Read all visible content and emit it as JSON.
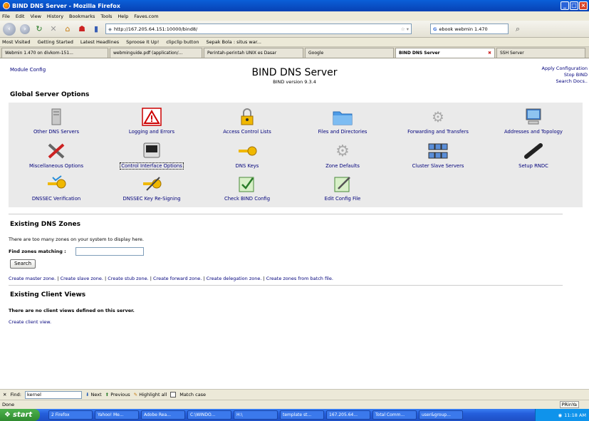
{
  "window": {
    "title": "BIND DNS Server - Mozilla Firefox"
  },
  "menu": [
    "File",
    "Edit",
    "View",
    "History",
    "Bookmarks",
    "Tools",
    "Help",
    "Faves.com"
  ],
  "url": "http://167.205.64.151:10000/bind8/",
  "search_value": "ebook webmin 1.470",
  "bookmarks": [
    "Most Visited",
    "Getting Started",
    "Latest Headlines",
    "Sproose It Up!",
    "clipclip button",
    "Sepak Bola : situs war..."
  ],
  "tabs": [
    {
      "label": "Webmin 1.470 on divkom-151...",
      "active": false
    },
    {
      "label": "webminguide.pdf (application/...",
      "active": false
    },
    {
      "label": "Perintah-perintah UNIX es Dasar",
      "active": false
    },
    {
      "label": "Google",
      "active": false
    },
    {
      "label": "BIND DNS Server",
      "active": true
    },
    {
      "label": "SSH Server",
      "active": false
    }
  ],
  "page": {
    "module_config": "Module Config",
    "title": "BIND DNS Server",
    "version": "BIND version 9.3.4",
    "right_links": [
      "Apply Configuration",
      "Stop BIND",
      "Search Docs.."
    ],
    "global_heading": "Global Server Options",
    "options": [
      {
        "label": "Other DNS Servers",
        "icon": "server-icon"
      },
      {
        "label": "Logging and Errors",
        "icon": "warning-icon"
      },
      {
        "label": "Access Control Lists",
        "icon": "lock-icon"
      },
      {
        "label": "Files and Directories",
        "icon": "folder-icon"
      },
      {
        "label": "Forwarding and Transfers",
        "icon": "gears-icon"
      },
      {
        "label": "Addresses and Topology",
        "icon": "monitor-icon"
      },
      {
        "label": "Miscellaneous Options",
        "icon": "tools-icon"
      },
      {
        "label": "Control Interface Options",
        "icon": "terminal-icon"
      },
      {
        "label": "DNS Keys",
        "icon": "key-icon"
      },
      {
        "label": "Zone Defaults",
        "icon": "gear-icon"
      },
      {
        "label": "Cluster Slave Servers",
        "icon": "cluster-icon"
      },
      {
        "label": "Setup RNDC",
        "icon": "remote-icon"
      },
      {
        "label": "DNSSEC Verification",
        "icon": "key-check-icon"
      },
      {
        "label": "DNSSEC Key Re-Signing",
        "icon": "key-sign-icon"
      },
      {
        "label": "Check BIND Config",
        "icon": "check-config-icon"
      },
      {
        "label": "Edit Config File",
        "icon": "edit-config-icon"
      }
    ],
    "zones_heading": "Existing DNS Zones",
    "zones_text": "There are too many zones on your system to display here.",
    "find_label": "Find zones matching :",
    "search_button": "Search",
    "create_links": [
      "Create master zone.",
      "Create slave zone.",
      "Create stub zone.",
      "Create forward zone.",
      "Create delegation zone.",
      "Create zones from batch file."
    ],
    "views_heading": "Existing Client Views",
    "views_text": "There are no client views defined on this server.",
    "create_view": "Create client view."
  },
  "findbar": {
    "label": "Find:",
    "value": "kernel",
    "next": "Next",
    "previous": "Previous",
    "highlight": "Highlight all",
    "match_case": "Match case"
  },
  "status": {
    "text": "Done",
    "badge": "PRinYa"
  },
  "taskbar": {
    "start": "start",
    "tasks": [
      "2 Firefox",
      "Yahoo! Me...",
      "Adobe Rea...",
      "C:\\WINDO...",
      "H:\\",
      "template st...",
      "167.205.64...",
      "Total Comm...",
      "user&group..."
    ],
    "clock": "11:18 AM"
  }
}
